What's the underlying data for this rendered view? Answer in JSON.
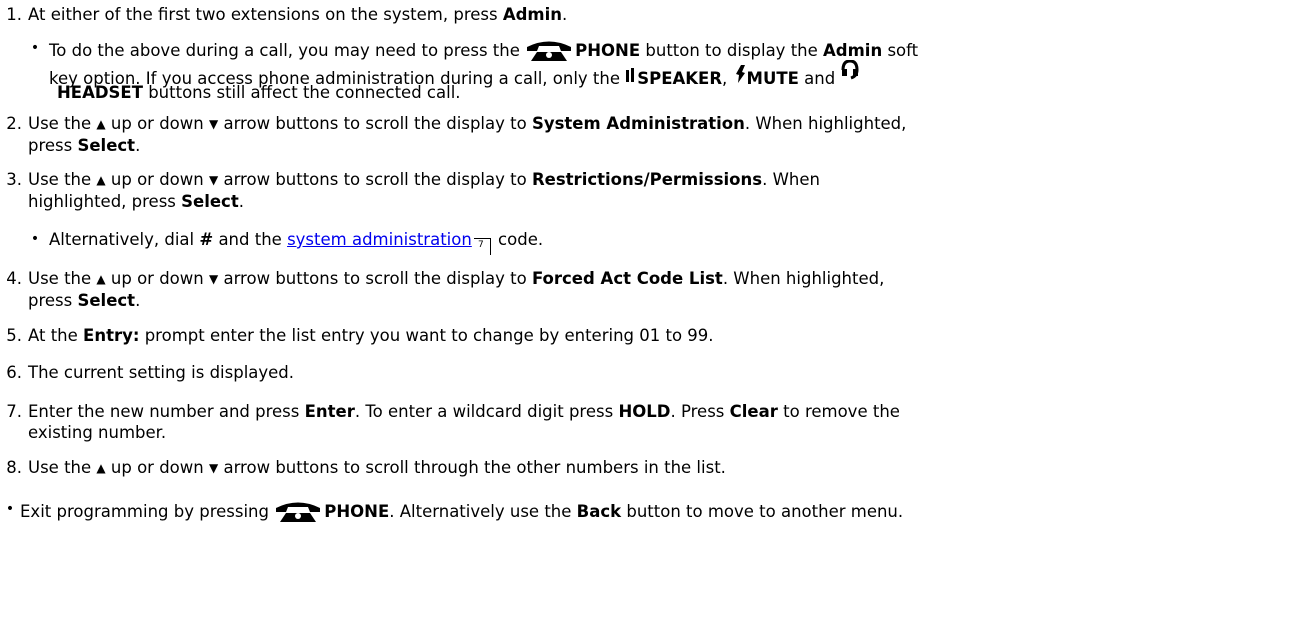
{
  "steps": [
    {
      "num": "1.",
      "a": "At either of the first two extensions on the system, press ",
      "b": "Admin",
      "c": "."
    },
    {
      "num": "2.",
      "a": "Use the ",
      "up": "up or down",
      "b": "arrow buttons to scroll the display to ",
      "bold": "System Administration",
      "c": ". When highlighted,",
      "line2a": "press ",
      "line2b": "Select",
      "line2c": "."
    },
    {
      "num": "3.",
      "a": "Use the ",
      "up": "up or down",
      "b": "arrow buttons to scroll the display to ",
      "bold": "Restrictions/Permissions",
      "c": ". When",
      "line2a": "highlighted, press ",
      "line2b": "Select",
      "line2c": "."
    },
    {
      "num": "4.",
      "a": "Use the ",
      "up": "up or down",
      "b": "arrow buttons to scroll the display to ",
      "bold": "Forced Act Code List",
      "c": ". When highlighted,",
      "line2a": "press ",
      "line2b": "Select",
      "line2c": "."
    },
    {
      "num": "5.",
      "a": "At the ",
      "bold": "Entry:",
      "c": " prompt enter the list entry you want to change by entering 01 to 99."
    },
    {
      "num": "6.",
      "a": "The current setting is displayed."
    },
    {
      "num": "7.",
      "a": "Enter the new number and press ",
      "b1": "Enter",
      "m1": ". To enter a wildcard digit press ",
      "b2": "HOLD",
      "m2": ". Press ",
      "b3": "Clear",
      "m3": " to remove the",
      "line2": "existing number."
    },
    {
      "num": "8.",
      "a": "Use the ",
      "up": "up or down",
      "b": "arrow buttons to scroll through the other numbers in the list."
    }
  ],
  "sub1": {
    "a": "To do the above during a call, you may need to press the ",
    "phone": "PHONE",
    "b": " button to display the ",
    "admin": "Admin",
    "c": " soft",
    "line2a": "key option. If you access phone administration during a call, only the ",
    "speaker": "SPEAKER",
    "comma": ", ",
    "mute": "MUTE",
    "and": " and ",
    "line3": "HEADSET",
    "line3b": " buttons still affect the connected call."
  },
  "sub3": {
    "a": "Alternatively, dial ",
    "hash": "#",
    "b": " and the ",
    "link": "system administration",
    "ref": "7",
    "c": " code."
  },
  "final": {
    "a": "Exit programming by pressing ",
    "phone": "PHONE",
    "b": ". Alternatively use the ",
    "back": "Back",
    "c": " button to move to another menu."
  },
  "icons": {
    "phone": "phone-icon",
    "speaker": "speaker-icon",
    "mute": "mute-icon",
    "headset": "headset-icon",
    "up": "up-arrow-icon",
    "down": "down-arrow-icon",
    "ref": "cross-reference-icon"
  }
}
